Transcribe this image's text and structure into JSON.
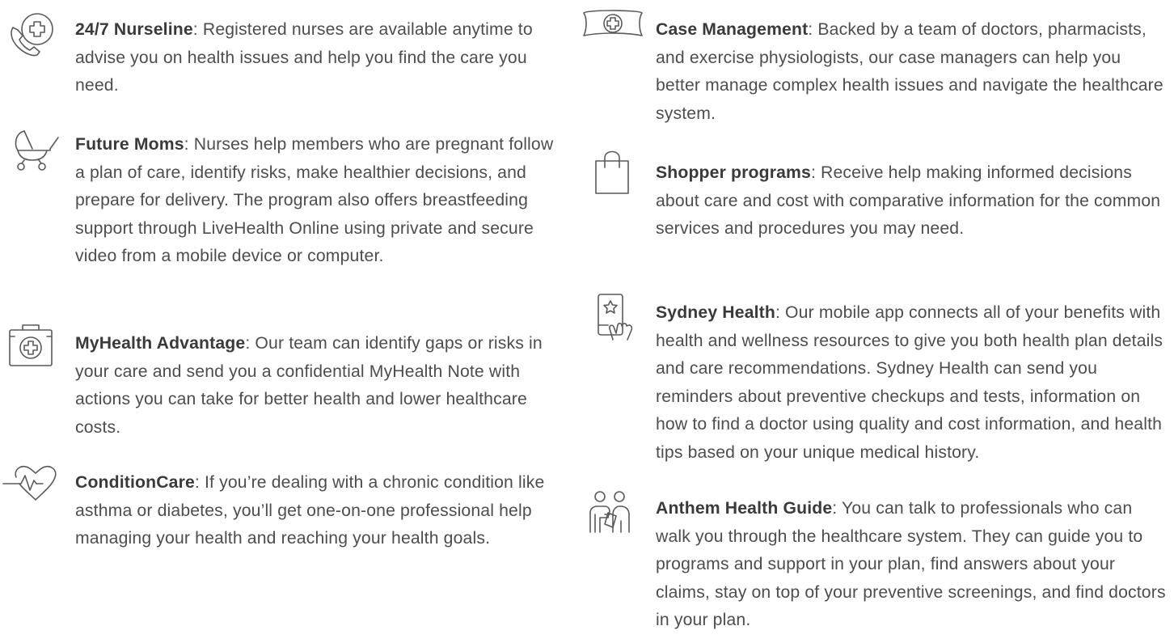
{
  "left_items": [
    {
      "icon": "phone-cross-icon",
      "name": "24/7 Nurseline",
      "sep": ":",
      "description": " Registered nurses are available anytime to advise you on health issues and help you find the care you need."
    },
    {
      "icon": "baby-stroller-icon",
      "name": "Future Moms",
      "sep": ":",
      "description": " Nurses help members who are pregnant follow a plan of care, identify risks, make healthier decisions, and prepare for delivery. The program also offers breastfeeding support through LiveHealth Online using private and secure video from a mobile device or computer."
    },
    {
      "icon": "medical-kit-icon",
      "name": "MyHealth Advantage",
      "sep": ":",
      "description": " Our team can identify gaps or risks in your care and send you a confidential MyHealth Note with actions you can take for better health and lower healthcare costs."
    },
    {
      "icon": "heartbeat-icon",
      "name": "ConditionCare",
      "sep": ":",
      "description": " If you’re dealing with a chronic condition like asthma or diabetes, you’ll get one-on-one professional help managing your health and reaching your health goals."
    }
  ],
  "right_items": [
    {
      "icon": "nurse-cap-icon",
      "name": "Case Management",
      "sep": ":",
      "description": " Backed by a team of doctors, pharmacists, and exercise physiologists, our case managers can help you better manage complex health issues and navigate the healthcare system."
    },
    {
      "icon": "shopping-bag-icon",
      "name": "Shopper programs",
      "sep": ":",
      "description": " Receive help making informed decisions about care and cost with comparative information for the common services and procedures you may need."
    },
    {
      "icon": "mobile-app-icon",
      "name": "Sydney Health",
      "sep": ":",
      "description": " Our mobile app connects all of your benefits with health and wellness resources to give you both health plan details and care recommendations. Sydney Health can send you reminders about preventive checkups and tests, information on how to find a doctor using quality and cost information, and health tips based on your unique medical history."
    },
    {
      "icon": "people-guide-icon",
      "name": "Anthem Health Guide",
      "sep": ":",
      "description": " You can talk to professionals who can walk you through the healthcare system. They can guide you to programs and support in your plan, find answers about your claims, stay on top of your preventive screenings, and find doctors in your plan."
    }
  ]
}
